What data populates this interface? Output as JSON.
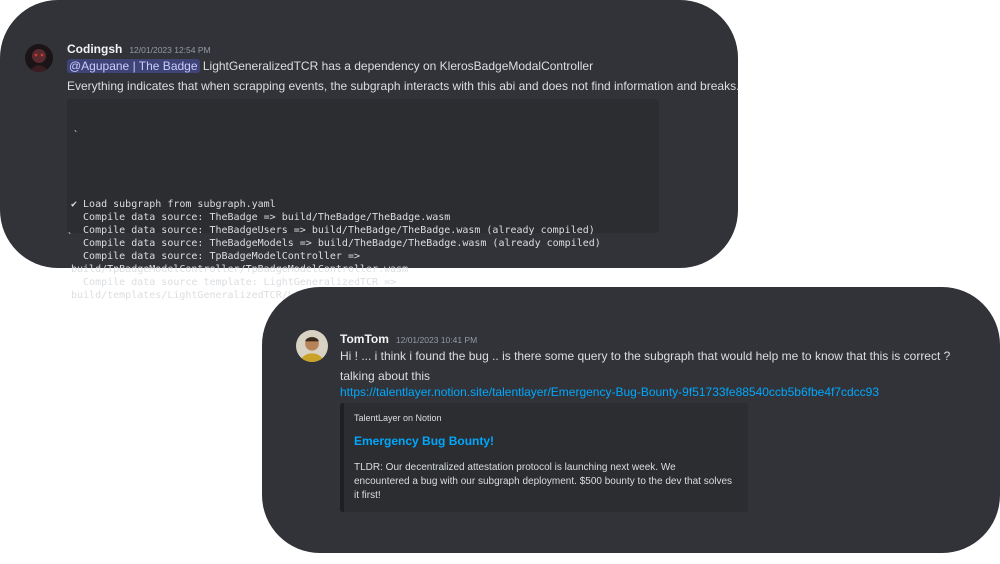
{
  "message1": {
    "username": "Codingsh",
    "timestamp": "12/01/2023 12:54 PM",
    "mention": "@Agupane | The Badge",
    "line1_rest": " LightGeneralizedTCR has a dependency on KlerosBadgeModalController",
    "line2": "Everything indicates that when scrapping events, the subgraph interacts with this abi and does not find information and breaks.",
    "code_open": "`",
    "code_lines": [
      "✔ Load subgraph from subgraph.yaml",
      "  Compile data source: TheBadge => build/TheBadge/TheBadge.wasm",
      "  Compile data source: TheBadgeUsers => build/TheBadge/TheBadge.wasm (already compiled)",
      "  Compile data source: TheBadgeModels => build/TheBadge/TheBadge.wasm (already compiled)",
      "  Compile data source: TpBadgeModelController =>",
      "build/TpBadgeModelController/TpBadgeModelController.wasm",
      "  Compile data source template: LightGeneralizedTCR =>",
      "build/templates/LightGeneralizedTCR/LightGeneralizedTCR.wasm"
    ],
    "code_close": "`"
  },
  "message2": {
    "username": "TomTom",
    "timestamp": "12/01/2023 10:41 PM",
    "line1": "Hi ! ... i think i found the bug .. is there some query to the subgraph that would help me to know that this is correct ?",
    "line2": "talking about this",
    "link": "https://talentlayer.notion.site/talentlayer/Emergency-Bug-Bounty-9f51733fe88540ccb5b6fbe4f7cdcc93",
    "embed": {
      "provider": "TalentLayer on Notion",
      "title": "Emergency Bug Bounty!",
      "description": "TLDR: Our decentralized attestation protocol is launching next week. We encountered a bug with our subgraph deployment. $500 bounty to the dev that solves it first!"
    }
  },
  "colors": {
    "card_bg": "#323338",
    "code_bg": "#2b2d31",
    "link": "#00a8fc",
    "mention_bg": "#4a4f8c"
  }
}
